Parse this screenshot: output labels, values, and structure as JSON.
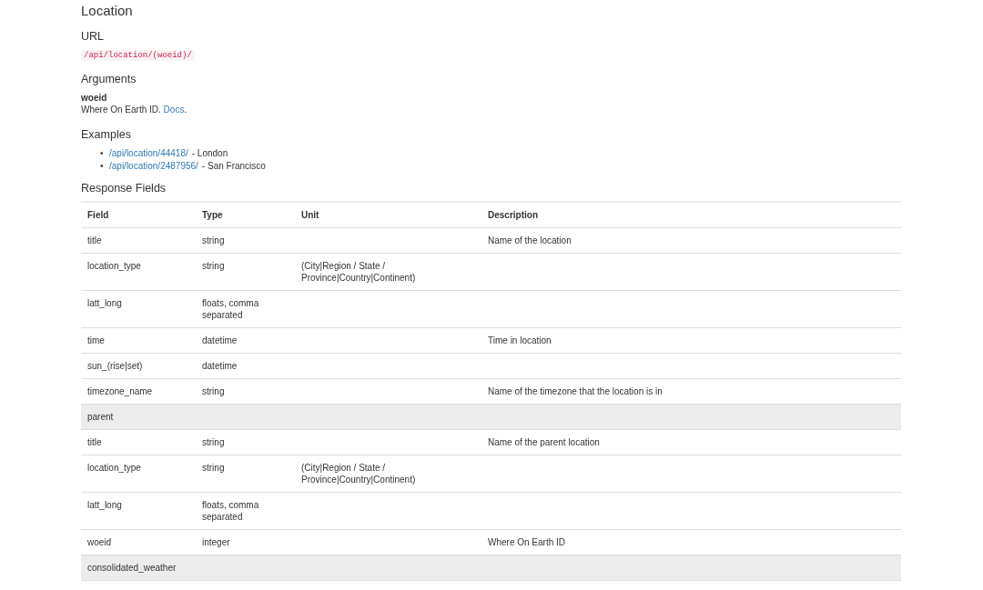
{
  "title": "Location",
  "url": {
    "heading": "URL",
    "code": "/api/location/(woeid)/"
  },
  "arguments": {
    "heading": "Arguments",
    "items": [
      {
        "name": "woeid",
        "text": "Where On Earth ID.",
        "link": "Docs",
        "suffix": "."
      }
    ]
  },
  "examples": {
    "heading": "Examples",
    "items": [
      {
        "marker": "•",
        "link": "/api/location/44418/",
        "text": "- London"
      },
      {
        "marker": "•",
        "link": "/api/location/2487956/",
        "text": "- San Francisco"
      }
    ]
  },
  "response_fields": {
    "heading": "Response Fields",
    "columns": [
      "Field",
      "Type",
      "Unit",
      "Description"
    ],
    "rows": [
      {
        "kind": "field",
        "cells": [
          "title",
          "string",
          "",
          "Name of the location"
        ]
      },
      {
        "kind": "field",
        "cells": [
          "location_type",
          "string",
          "(City|Region / State / Province|Country|Continent)",
          ""
        ]
      },
      {
        "kind": "field",
        "cells": [
          "latt_long",
          "floats, comma separated",
          "",
          ""
        ]
      },
      {
        "kind": "field",
        "cells": [
          "time",
          "datetime",
          "",
          "Time in location"
        ]
      },
      {
        "kind": "field",
        "cells": [
          "sun_(rise|set)",
          "datetime",
          "",
          ""
        ]
      },
      {
        "kind": "field",
        "cells": [
          "timezone_name",
          "string",
          "",
          "Name of the timezone that the location is in"
        ]
      },
      {
        "kind": "group",
        "cells": [
          "parent",
          "",
          "",
          ""
        ]
      },
      {
        "kind": "field",
        "cells": [
          "title",
          "string",
          "",
          "Name of the parent location"
        ]
      },
      {
        "kind": "field",
        "cells": [
          "location_type",
          "string",
          "(City|Region / State / Province|Country|Continent)",
          ""
        ]
      },
      {
        "kind": "field",
        "cells": [
          "latt_long",
          "floats, comma separated",
          "",
          ""
        ]
      },
      {
        "kind": "field",
        "cells": [
          "woeid",
          "integer",
          "",
          "Where On Earth ID"
        ]
      },
      {
        "kind": "group",
        "cells": [
          "consolidated_weather",
          "",
          "",
          ""
        ]
      }
    ]
  }
}
